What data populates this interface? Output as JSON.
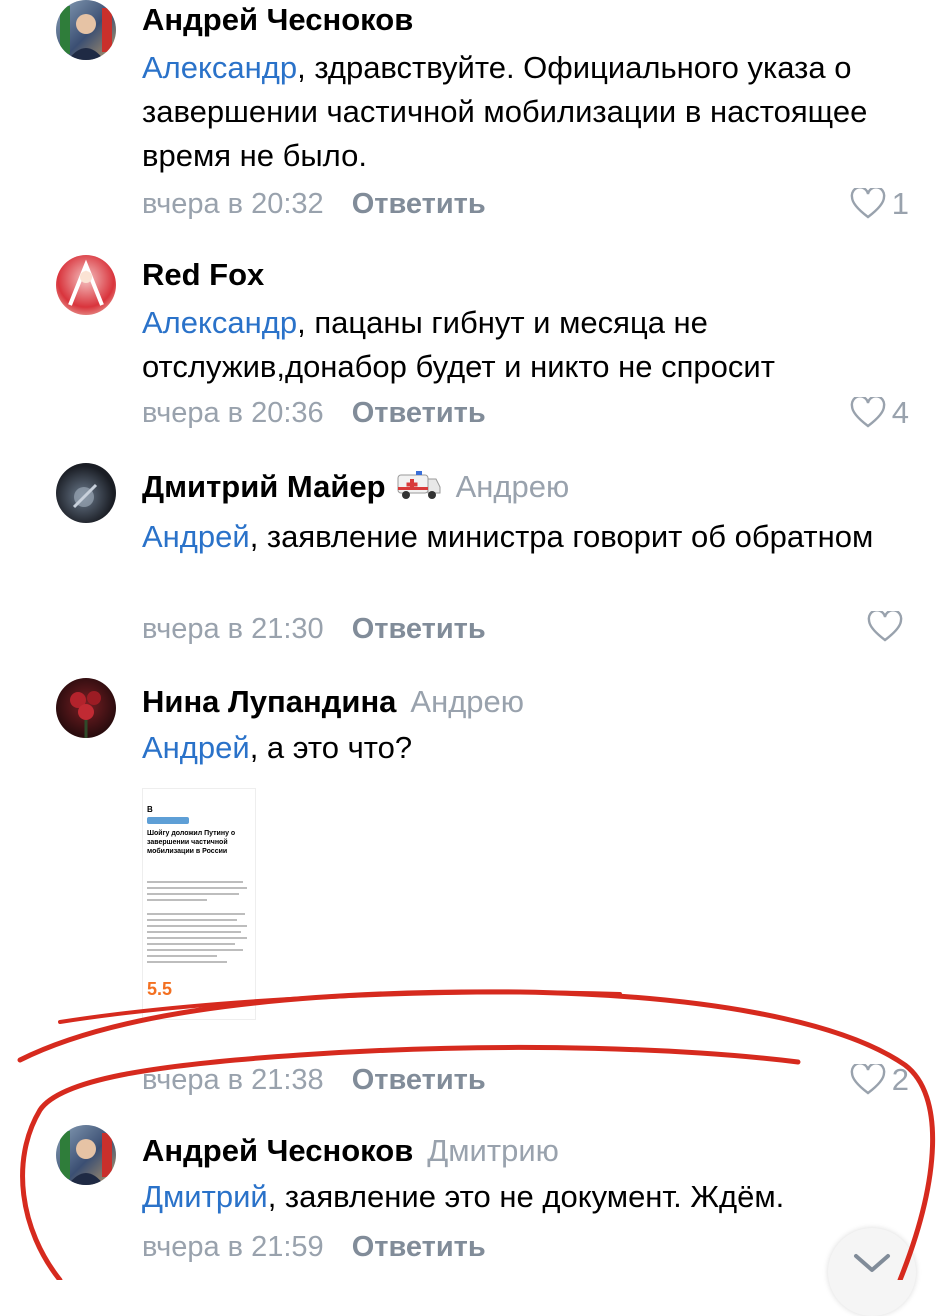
{
  "comments": [
    {
      "author": "Андрей Чесноков",
      "reply_to": "",
      "mention": "Александр",
      "text": ", здравствуйте. Официального указа о завершении частичной мобилизации в настоящее время не было.",
      "time": "вчера в 20:32",
      "reply_label": "Ответить",
      "likes": "1"
    },
    {
      "author": "Red Fox",
      "reply_to": "",
      "mention": "Александр",
      "text": ", пацаны гибнут и месяца не отслужив,донабор будет и никто не спросит",
      "time": "вчера в 20:36",
      "reply_label": "Ответить",
      "likes": "4"
    },
    {
      "author": "Дмитрий Майер",
      "emoji": "🚑",
      "reply_to": "Андрею",
      "mention": "Андрей",
      "text": ", заявление министра говорит об обратном",
      "time": "вчера в 21:30",
      "reply_label": "Ответить",
      "likes": ""
    },
    {
      "author": "Нина Лупандина",
      "reply_to": "Андрею",
      "mention": "Андрей",
      "text": ", а это что?",
      "time": "вчера в 21:38",
      "reply_label": "Ответить",
      "likes": "2",
      "attachment": {
        "headline": "Шойгу доложил Путину о завершении частичной мобилизации в России",
        "ad_text": "5.5"
      }
    },
    {
      "author": "Андрей Чесноков",
      "reply_to": "Дмитрию",
      "mention": "Дмитрий",
      "text": ", заявление это не документ. Ждём.",
      "time": "вчера в 21:59",
      "reply_label": "Ответить",
      "likes": ""
    }
  ],
  "colors": {
    "mention": "#2a72c9",
    "secondary": "#99a2ad",
    "annotation": "#d62a1e"
  }
}
